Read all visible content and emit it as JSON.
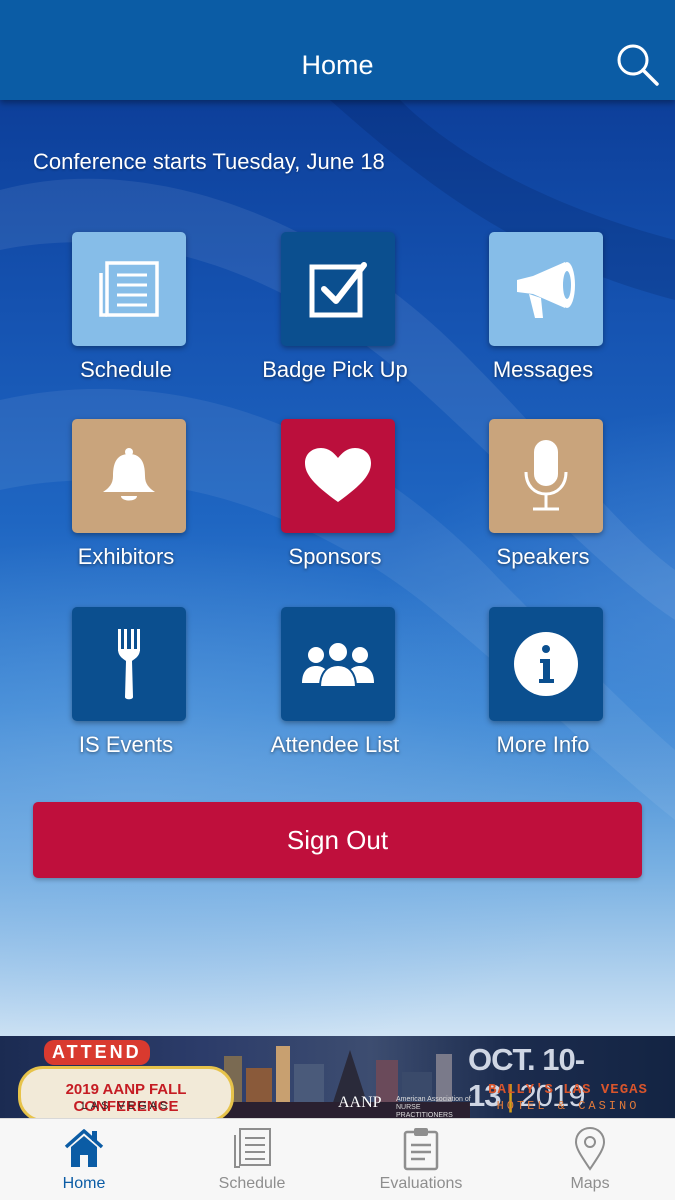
{
  "header": {
    "title": "Home",
    "search_icon": "search-icon"
  },
  "notice": "Conference starts Tuesday, June 18",
  "tiles": [
    {
      "label": "Schedule",
      "icon": "document-icon",
      "color": "#86bde8"
    },
    {
      "label": "Badge Pick Up",
      "icon": "checkbox-icon",
      "color": "#0b4f8f"
    },
    {
      "label": "Messages",
      "icon": "megaphone-icon",
      "color": "#86bde8"
    },
    {
      "label": "Exhibitors",
      "icon": "bell-icon",
      "color": "#c9a47c"
    },
    {
      "label": "Sponsors",
      "icon": "heart-icon",
      "color": "#bb0f3c"
    },
    {
      "label": "Speakers",
      "icon": "microphone-icon",
      "color": "#c9a47c"
    },
    {
      "label": "IS Events",
      "icon": "fork-icon",
      "color": "#0b4f8f"
    },
    {
      "label": "Attendee List",
      "icon": "people-icon",
      "color": "#0b4f8f"
    },
    {
      "label": "More Info",
      "icon": "info-icon",
      "color": "#0b4f8f"
    }
  ],
  "sign_out": {
    "label": "Sign Out",
    "color": "#bf0f3c"
  },
  "banner": {
    "sign_top": "ATTEND",
    "sign_main": "2019 AANP FALL CONFERENCE",
    "sign_sub": "LAS VEGAS",
    "org": "AANP",
    "org_full": "American Association of NURSE PRACTITIONERS",
    "dates": "OCT. 10-13",
    "year": "2019",
    "venue": "BALLY'S LAS VEGAS",
    "venue_sub": "HOTEL & CASINO"
  },
  "tabbar": {
    "items": [
      {
        "label": "Home",
        "icon": "home-icon",
        "active": true
      },
      {
        "label": "Schedule",
        "icon": "document-icon",
        "active": false
      },
      {
        "label": "Evaluations",
        "icon": "clipboard-icon",
        "active": false
      },
      {
        "label": "Maps",
        "icon": "map-pin-icon",
        "active": false
      }
    ],
    "active_color": "#0b5ca5",
    "inactive_color": "#8e8e8e"
  }
}
